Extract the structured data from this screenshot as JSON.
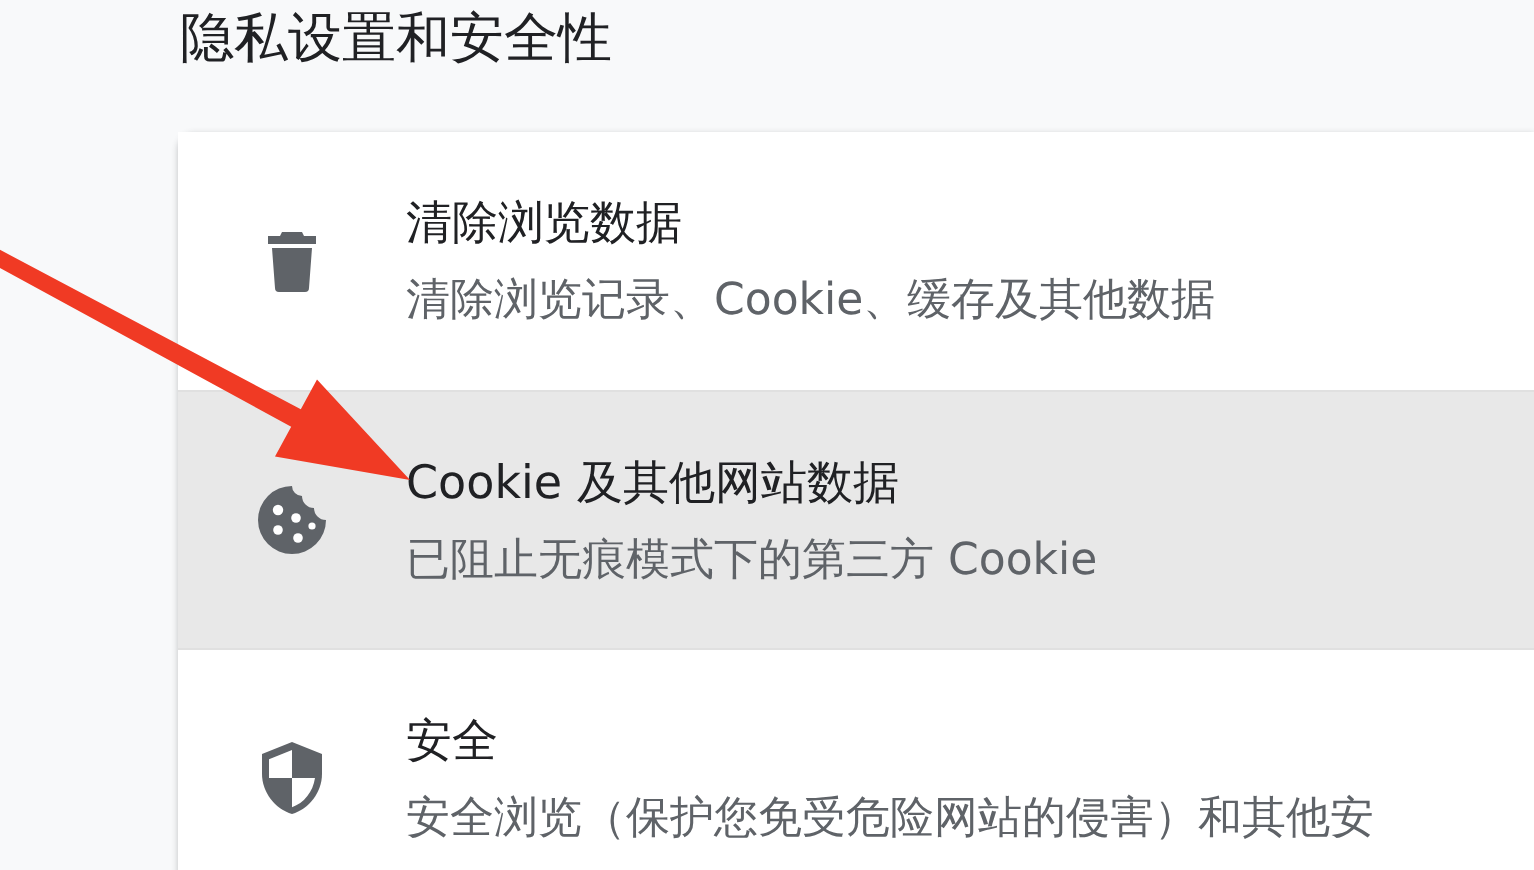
{
  "section_title": "隐私设置和安全性",
  "items": [
    {
      "kind": "trash",
      "title": "清除浏览数据",
      "subtitle": "清除浏览记录、Cookie、缓存及其他数据",
      "selected": false
    },
    {
      "kind": "cookie",
      "title": "Cookie 及其他网站数据",
      "subtitle": "已阻止无痕模式下的第三方 Cookie",
      "selected": true
    },
    {
      "kind": "shield",
      "title": "安全",
      "subtitle": "安全浏览（保护您免受危险网站的侵害）和其他安",
      "selected": false
    }
  ]
}
